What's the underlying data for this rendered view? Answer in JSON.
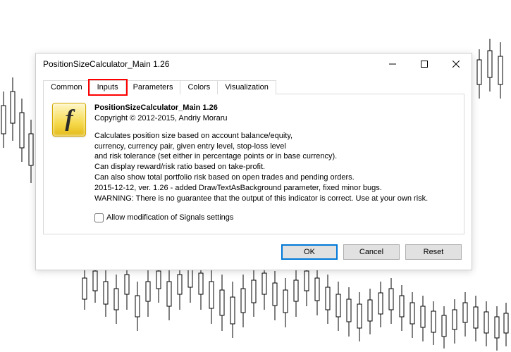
{
  "dialog": {
    "title": "PositionSizeCalculator_Main 1.26",
    "tabs": {
      "common": "Common",
      "inputs": "Inputs",
      "parameters": "Parameters",
      "colors": "Colors",
      "visualization": "Visualization"
    },
    "info": {
      "heading": "PositionSizeCalculator_Main 1.26",
      "copyright": "Copyright © 2012-2015, Andriy Moraru",
      "desc": "Calculates position size based on account balance/equity,\ncurrency, currency pair, given entry level, stop-loss level\nand risk tolerance (set either in percentage points or in base currency).\nCan display reward/risk ratio based on take-profit.\nCan also show total portfolio risk based on open trades and pending orders.\n2015-12-12, ver. 1.26 - added DrawTextAsBackground parameter, fixed minor bugs.\nWARNING: There is no guarantee that the output of this indicator is correct. Use at your own risk."
    },
    "checkbox": {
      "label": "Allow modification of Signals settings",
      "checked": false
    },
    "buttons": {
      "ok": "OK",
      "cancel": "Cancel",
      "reset": "Reset"
    }
  },
  "icon": {
    "name": "function-icon",
    "glyph": "f"
  }
}
